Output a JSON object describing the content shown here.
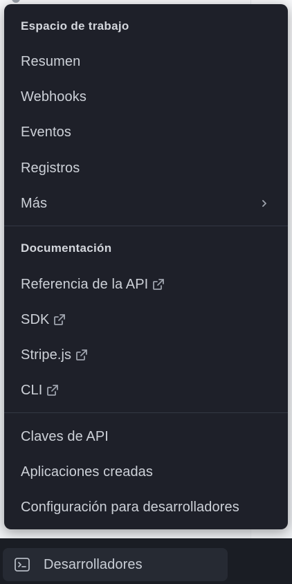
{
  "menu": {
    "workspace": {
      "title": "Espacio de trabajo",
      "items": [
        {
          "label": "Resumen"
        },
        {
          "label": "Webhooks"
        },
        {
          "label": "Eventos"
        },
        {
          "label": "Registros"
        },
        {
          "label": "Más",
          "icon": "chevron-right-icon"
        }
      ]
    },
    "docs": {
      "title": "Documentación",
      "items": [
        {
          "label": "Referencia de la API",
          "icon": "external-link-icon"
        },
        {
          "label": "SDK",
          "icon": "external-link-icon"
        },
        {
          "label": "Stripe.js",
          "icon": "external-link-icon"
        },
        {
          "label": "CLI",
          "icon": "external-link-icon"
        }
      ]
    },
    "other": {
      "items": [
        {
          "label": "Claves de API"
        },
        {
          "label": "Aplicaciones creadas"
        },
        {
          "label": "Configuración para desarrolladores"
        }
      ]
    }
  },
  "taskbar": {
    "developers_label": "Desarrolladores",
    "icon": "terminal-icon"
  },
  "colors": {
    "menu_background": "#1e2029",
    "menu_text": "#cdd1d8",
    "section_title": "#d4d7dd",
    "divider": "#343844",
    "taskbar_background": "#1a1d24",
    "taskbar_item_background": "#262a33"
  }
}
